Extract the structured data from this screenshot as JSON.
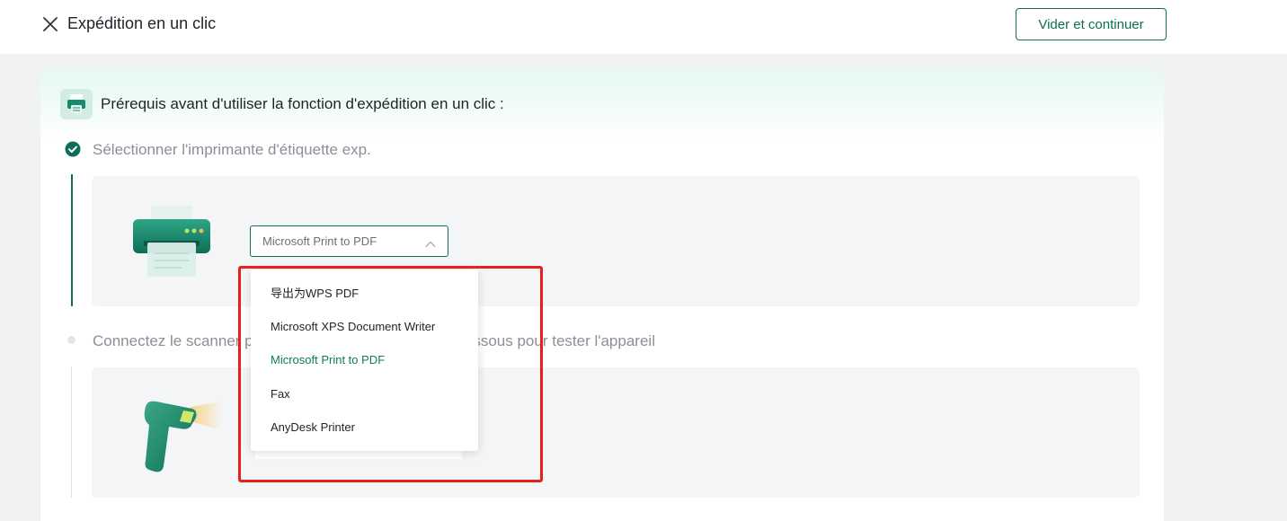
{
  "header": {
    "title": "Expédition en un clic",
    "clear_button_label": "Vider et continuer"
  },
  "prerequisites": {
    "title": "Prérequis avant d'utiliser la fonction d'expédition en un clic :"
  },
  "step1": {
    "label": "Sélectionner l'imprimante d'étiquette exp.",
    "status": "completed",
    "printer_select": {
      "selected_value": "Microsoft Print to PDF",
      "options": [
        "导出为WPS PDF",
        "Microsoft XPS Document Writer",
        "Microsoft Print to PDF",
        "Fax",
        "AnyDesk Printer"
      ]
    }
  },
  "step2": {
    "label": "Connectez le scanner pour scanner le code-barres ci-dessous pour tester l'appareil",
    "status": "pending"
  },
  "colors": {
    "accent": "#0e6e57",
    "selected_option": "#0e7a5f",
    "highlight_box": "#e8201b"
  }
}
